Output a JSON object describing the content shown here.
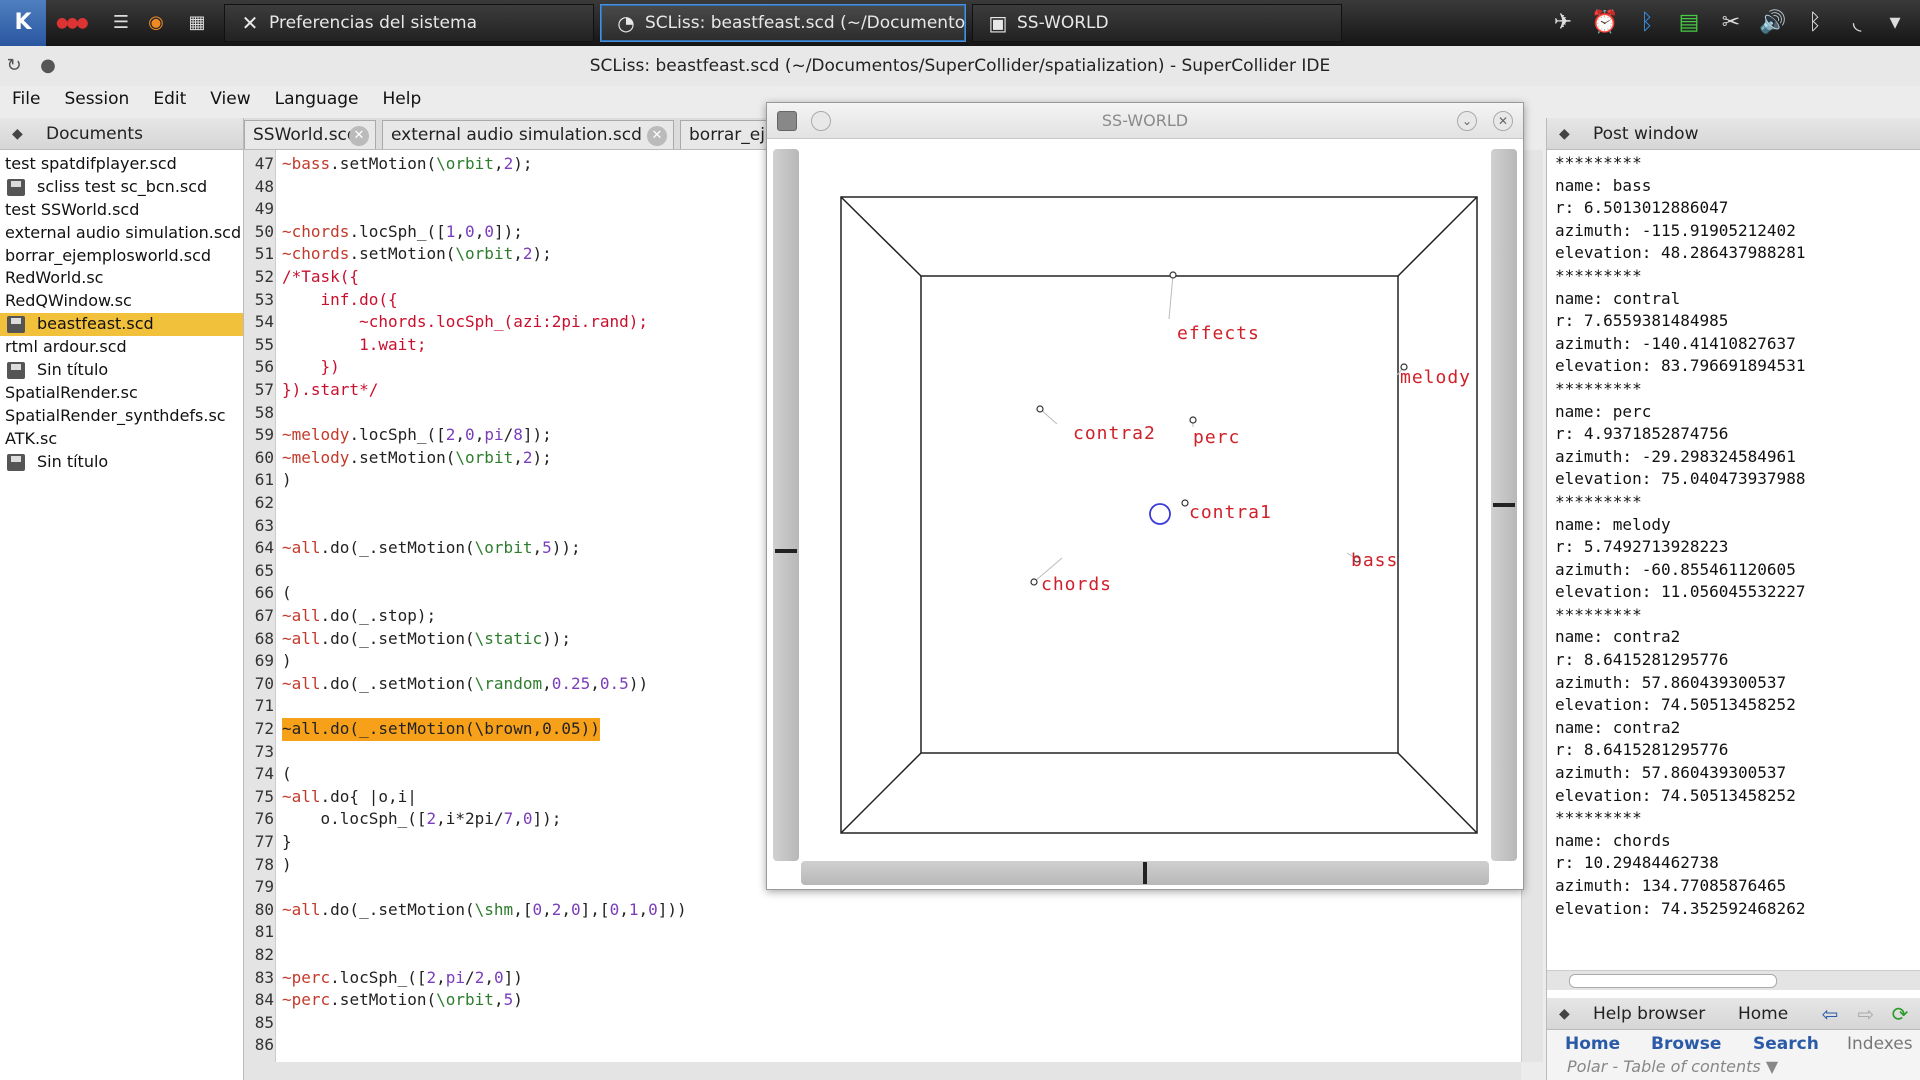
{
  "taskbar": {
    "menu_icon": "kde-logo-icon",
    "tasks": [
      {
        "label": "Preferencias del sistema",
        "icon": "settings-tools-icon"
      },
      {
        "label": "SCLiss: beastfeast.scd (~/Documento",
        "icon": "supercollider-icon"
      },
      {
        "label": "SS-WORLD",
        "icon": "window-icon"
      }
    ]
  },
  "ide": {
    "title": "SCLiss: beastfeast.scd (~/Documentos/SuperCollider/spatialization) - SuperCollider IDE",
    "menu": [
      "File",
      "Session",
      "Edit",
      "View",
      "Language",
      "Help"
    ]
  },
  "documents": {
    "header": "Documents",
    "items": [
      {
        "label": "test spatdifplayer.scd",
        "saved": false,
        "selected": false
      },
      {
        "label": "scliss test sc_bcn.scd",
        "saved": true,
        "selected": false
      },
      {
        "label": "test SSWorld.scd",
        "saved": false,
        "selected": false
      },
      {
        "label": "external audio simulation.scd",
        "saved": false,
        "selected": false
      },
      {
        "label": "borrar_ejemplosworld.scd",
        "saved": false,
        "selected": false
      },
      {
        "label": "RedWorld.sc",
        "saved": false,
        "selected": false
      },
      {
        "label": "RedQWindow.sc",
        "saved": false,
        "selected": false
      },
      {
        "label": "beastfeast.scd",
        "saved": true,
        "selected": true
      },
      {
        "label": "rtml ardour.scd",
        "saved": false,
        "selected": false
      },
      {
        "label": "Sin título",
        "saved": true,
        "selected": false
      },
      {
        "label": "SpatialRender.sc",
        "saved": false,
        "selected": false
      },
      {
        "label": "SpatialRender_synthdefs.sc",
        "saved": false,
        "selected": false
      },
      {
        "label": "ATK.sc",
        "saved": false,
        "selected": false
      },
      {
        "label": "Sin título",
        "saved": true,
        "selected": false
      }
    ]
  },
  "editor": {
    "tabs": [
      "SSWorld.scd",
      "external audio simulation.scd",
      "borrar_eje"
    ],
    "lines": [
      {
        "n": "47",
        "code": "~bass.setMotion(\\orbit,2);"
      },
      {
        "n": "48",
        "code": ""
      },
      {
        "n": "49",
        "code": ""
      },
      {
        "n": "50",
        "code": "~chords.locSph_([1,0,0]);"
      },
      {
        "n": "51",
        "code": "~chords.setMotion(\\orbit,2);"
      },
      {
        "n": "52",
        "code": "/*Task({",
        "comment": true
      },
      {
        "n": "53",
        "code": "    inf.do({",
        "comment": true
      },
      {
        "n": "54",
        "code": "        ~chords.locSph_(azi:2pi.rand);",
        "comment": true
      },
      {
        "n": "55",
        "code": "        1.wait;",
        "comment": true
      },
      {
        "n": "56",
        "code": "    })",
        "comment": true
      },
      {
        "n": "57",
        "code": "}).start*/",
        "comment": true
      },
      {
        "n": "58",
        "code": ""
      },
      {
        "n": "59",
        "code": "~melody.locSph_([2,0,pi/8]);"
      },
      {
        "n": "60",
        "code": "~melody.setMotion(\\orbit,2);"
      },
      {
        "n": "61",
        "code": ")"
      },
      {
        "n": "62",
        "code": ""
      },
      {
        "n": "63",
        "code": ""
      },
      {
        "n": "64",
        "code": "~all.do(_.setMotion(\\orbit,5));"
      },
      {
        "n": "65",
        "code": ""
      },
      {
        "n": "66",
        "code": "("
      },
      {
        "n": "67",
        "code": "~all.do(_.stop);"
      },
      {
        "n": "68",
        "code": "~all.do(_.setMotion(\\static));"
      },
      {
        "n": "69",
        "code": ")"
      },
      {
        "n": "70",
        "code": "~all.do(_.setMotion(\\random,0.25,0.5))"
      },
      {
        "n": "71",
        "code": ""
      },
      {
        "n": "72",
        "code": "~all.do(_.setMotion(\\brown,0.05))",
        "highlight": true
      },
      {
        "n": "73",
        "code": ""
      },
      {
        "n": "74",
        "code": "("
      },
      {
        "n": "75",
        "code": "~all.do{ |o,i|"
      },
      {
        "n": "76",
        "code": "    o.locSph_([2,i*2pi/7,0]);"
      },
      {
        "n": "77",
        "code": "}"
      },
      {
        "n": "78",
        "code": ")"
      },
      {
        "n": "79",
        "code": ""
      },
      {
        "n": "80",
        "code": "~all.do(_.setMotion(\\shm,[0,2,0],[0,1,0]))"
      },
      {
        "n": "81",
        "code": ""
      },
      {
        "n": "82",
        "code": ""
      },
      {
        "n": "83",
        "code": "~perc.locSph_([2,pi/2,0])"
      },
      {
        "n": "84",
        "code": "~perc.setMotion(\\orbit,5)"
      },
      {
        "n": "85",
        "code": ""
      },
      {
        "n": "86",
        "code": ""
      }
    ]
  },
  "ssworld": {
    "title": "SS-WORLD",
    "objects": [
      {
        "label": "effects"
      },
      {
        "label": "melody"
      },
      {
        "label": "contra2"
      },
      {
        "label": "perc"
      },
      {
        "label": "contra1"
      },
      {
        "label": "bass"
      },
      {
        "label": "chords"
      }
    ]
  },
  "post": {
    "header": "Post window",
    "lines": [
      "*********",
      "name: bass",
      "r: 6.5013012886047",
      "azimuth: -115.91905212402",
      "elevation: 48.286437988281",
      "*********",
      "name: contral",
      "r: 7.6559381484985",
      "azimuth: -140.41410827637",
      "elevation: 83.796691894531",
      "*********",
      "name: perc",
      "r: 4.9371852874756",
      "azimuth: -29.298324584961",
      "elevation: 75.040473937988",
      "*********",
      "name: melody",
      "r: 5.7492713928223",
      "azimuth: -60.855461120605",
      "elevation: 11.056045532227",
      "*********",
      "name: contra2",
      "r: 8.6415281295776",
      "azimuth: 57.860439300537",
      "elevation: 74.50513458252",
      "name: contra2",
      "r: 8.6415281295776",
      "azimuth: 57.860439300537",
      "elevation: 74.50513458252",
      "*********",
      "name: chords",
      "r: 10.29484462738",
      "azimuth: 134.77085876465",
      "elevation: 74.352592468262"
    ]
  },
  "help": {
    "header": "Help browser",
    "home_label": "Home",
    "tabs": [
      "Home",
      "Browse",
      "Search",
      "Indexes"
    ],
    "toc": "Polar - Table of contents ▼"
  },
  "colors": {
    "selected_doc": "#f2c13c",
    "highlight_line": "#f7a11a",
    "ss_label": "#d0202a",
    "help_link": "#2b5aa8"
  }
}
